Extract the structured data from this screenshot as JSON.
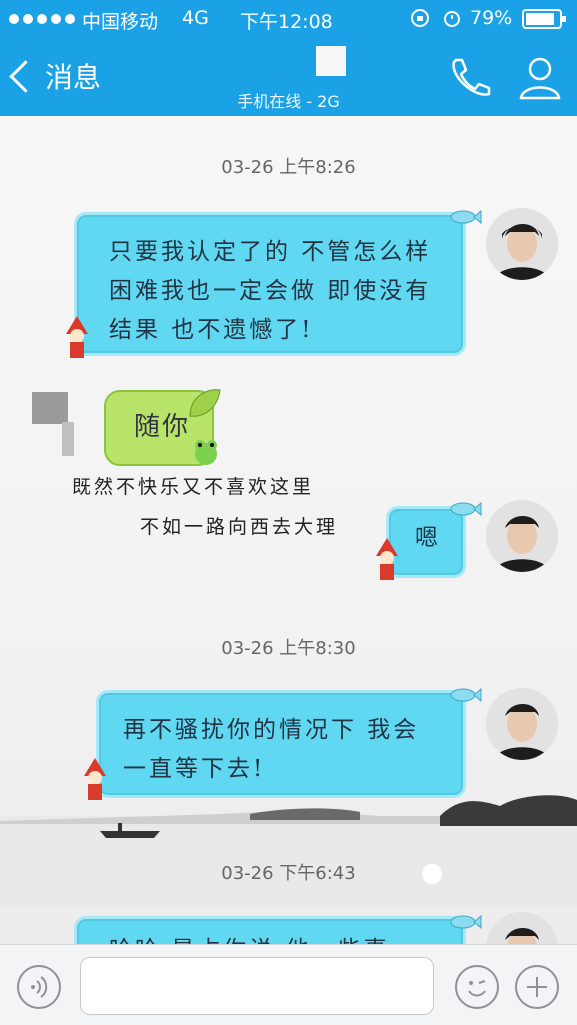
{
  "status": {
    "carrier": "中国移动",
    "network": "4G",
    "time": "下午12:08",
    "battery": "79%"
  },
  "nav": {
    "back_label": "消息",
    "subtitle": "手机在线 - 2G",
    "icons": [
      "phone-icon",
      "profile-icon"
    ]
  },
  "messages": {
    "t1": "03-26 上午8:26",
    "m1": "只要我认定了的 不管怎么样困难我也一定会做 即使没有结果 也不遗憾了!",
    "m2": "随你",
    "m2_caption1": "既然不快乐又不喜欢这里",
    "m2_caption2": "不如一路向西去大理",
    "m3": "嗯",
    "t2": "03-26 上午8:30",
    "m4": "再不骚扰你的情况下 我会一直等下去!",
    "t3": "03-26 下午6:43",
    "m5": "哈哈 是占你说 他一些事"
  },
  "inputbar": {
    "icons": [
      "voice-icon",
      "emoji-icon",
      "plus-icon"
    ],
    "input_value": ""
  },
  "colors": {
    "header": "#1aa1e6",
    "bubble_blue": "#61d8f1",
    "bubble_green": "#b8e46a"
  }
}
